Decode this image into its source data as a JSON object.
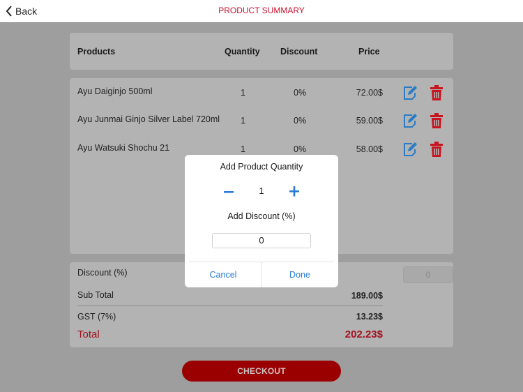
{
  "navbar": {
    "back_label": "Back",
    "title": "PRODUCT SUMMARY"
  },
  "table": {
    "headers": {
      "product": "Products",
      "quantity": "Quantity",
      "discount": "Discount",
      "price": "Price"
    },
    "rows": [
      {
        "product": "Ayu Daiginjo 500ml",
        "quantity": "1",
        "discount": "0%",
        "price": "72.00$"
      },
      {
        "product": "Ayu Junmai Ginjo Silver Label 720ml",
        "quantity": "1",
        "discount": "0%",
        "price": "59.00$"
      },
      {
        "product": "Ayu Watsuki Shochu 21",
        "quantity": "1",
        "discount": "0%",
        "price": "58.00$"
      }
    ],
    "row_icons": {
      "edit": "edit-icon",
      "delete": "trash-icon"
    }
  },
  "totals": {
    "discount_label": "Discount (%)",
    "discount_value": "0",
    "subtotal_label": "Sub Total",
    "subtotal_value": "189.00$",
    "gst_label": "GST (7%)",
    "gst_value": "13.23$",
    "total_label": "Total",
    "total_value": "202.23$"
  },
  "checkout_label": "CHECKOUT",
  "dialog": {
    "title": "Add Product Quantity",
    "quantity": "1",
    "discount_title": "Add Discount (%)",
    "discount_value": "0",
    "cancel_label": "Cancel",
    "done_label": "Done"
  },
  "colors": {
    "accent_red": "#c8102e",
    "total_red": "#a3121f",
    "checkout_red": "#9b0000",
    "link_blue": "#2a7bd6",
    "edit_blue": "#2b7cc4",
    "delete_red": "#c8141e"
  }
}
